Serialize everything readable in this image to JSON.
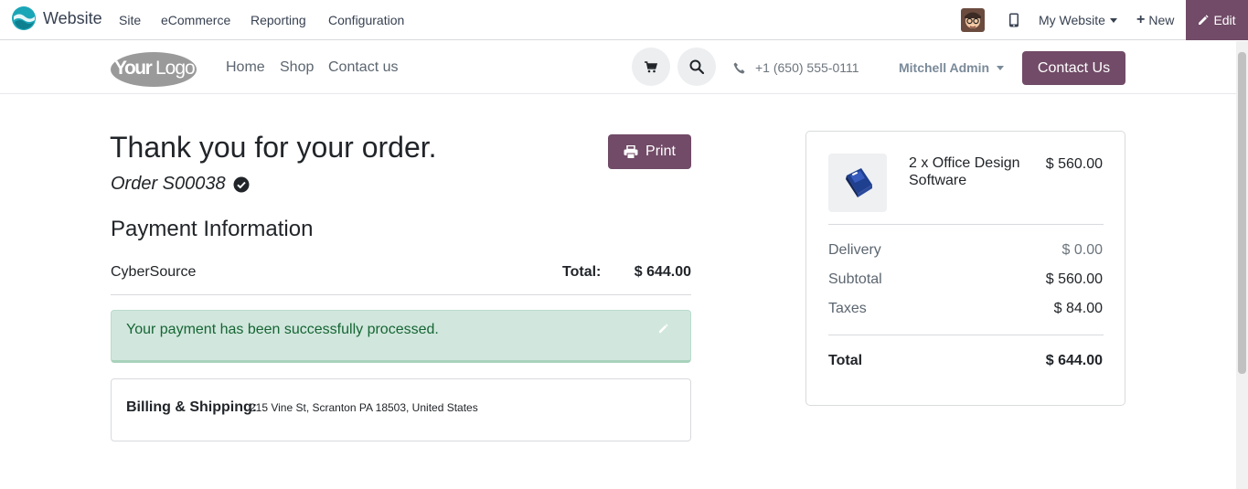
{
  "adminbar": {
    "app_name": "Website",
    "menus": [
      "Site",
      "eCommerce",
      "Reporting",
      "Configuration"
    ],
    "website_selector": "My Website",
    "new_label": "New",
    "edit_label": "Edit",
    "brand_colors": {
      "accent": "#714B67"
    }
  },
  "header": {
    "logo_text": "YourLogo",
    "nav": [
      "Home",
      "Shop",
      "Contact us"
    ],
    "phone": "+1 (650) 555-0111",
    "user": "Mitchell Admin",
    "contact_button": "Contact Us"
  },
  "confirmation": {
    "title": "Thank you for your order.",
    "order_ref": "Order S00038",
    "print_label": "Print",
    "payment_heading": "Payment Information",
    "provider": "CyberSource",
    "total_label": "Total:",
    "total_value": "$ 644.00",
    "success_message": "Your payment has been successfully processed.",
    "billing_label": "Billing & Shipping:",
    "billing_address": "215 Vine St, Scranton PA 18503, United States"
  },
  "summary": {
    "item": {
      "name": "2 x Office Design Software",
      "price": "$ 560.00"
    },
    "rows": [
      {
        "label": "Delivery",
        "value": "$ 0.00"
      },
      {
        "label": "Subtotal",
        "value": "$ 560.00"
      },
      {
        "label": "Taxes",
        "value": "$ 84.00"
      }
    ],
    "total_label": "Total",
    "total_value": "$ 644.00"
  }
}
